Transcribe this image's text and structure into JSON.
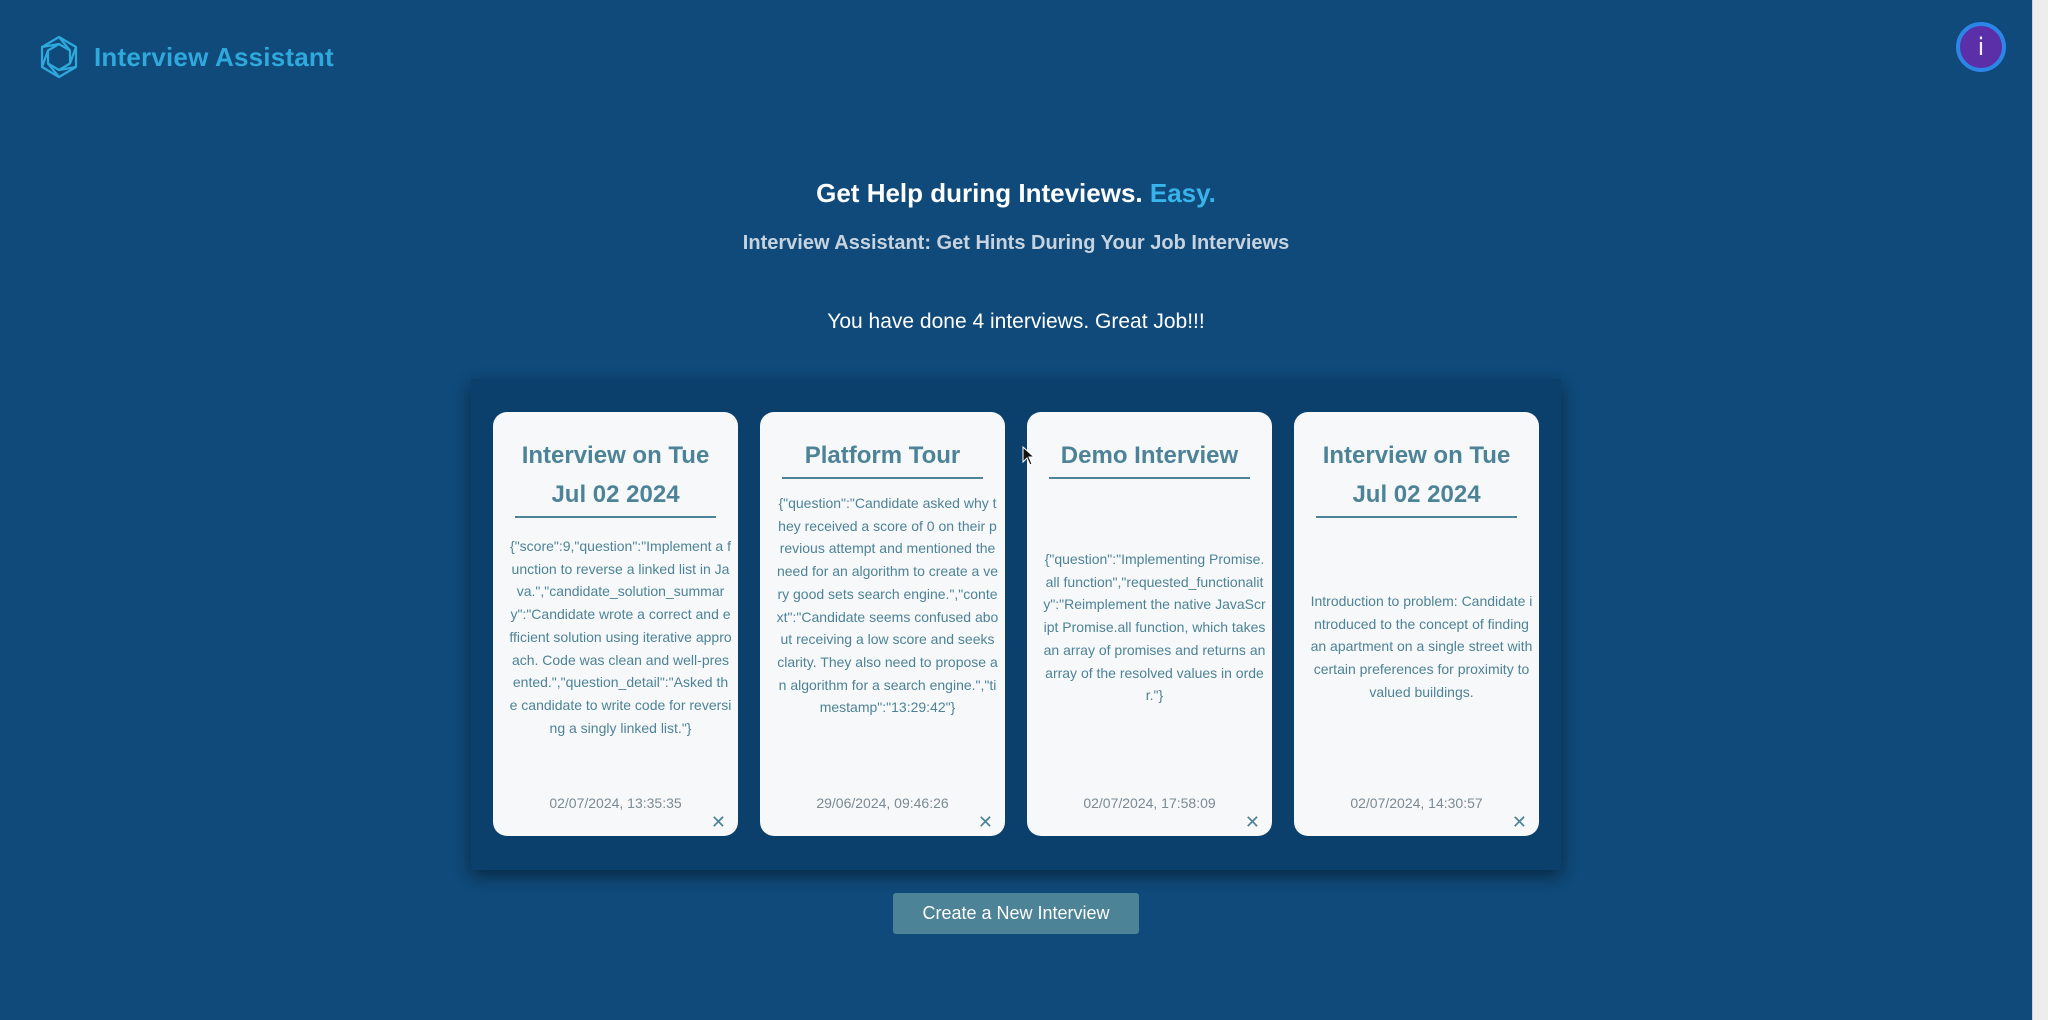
{
  "header": {
    "app_title": "Interview Assistant",
    "logo_icon": "hexagon-spiral-logo-icon",
    "avatar_letter": "i",
    "avatar_color": "#5a2fa8"
  },
  "hero": {
    "title_main": "Get Help during Inteviews. ",
    "title_accent": "Easy.",
    "subtitle": "Interview Assistant: Get Hints During Your Job Interviews",
    "count_text": "You have done 4 interviews. Great Job!!!"
  },
  "cards": [
    {
      "title": "Interview on Tue Jul 02 2024",
      "body": "{\"score\":9,\"question\":\"Implement a function to reverse a linked list in Java.\",\"candidate_solution_summary\":\"Candidate wrote a correct and efficient solution using iterative approach. Code was clean and well-presented.\",\"question_detail\":\"Asked the candidate to write code for reversing a singly linked list.\"}",
      "timestamp": "02/07/2024, 13:35:35"
    },
    {
      "title": "Platform Tour",
      "body": "{\"question\":\"Candidate asked why they received a score of 0 on their previous attempt and mentioned the need for an algorithm to create a very good sets search engine.\",\"context\":\"Candidate seems confused about receiving a low score and seeks clarity. They also need to propose an algorithm for a search engine.\",\"timestamp\":\"13:29:42\"}",
      "timestamp": "29/06/2024, 09:46:26"
    },
    {
      "title": "Demo Interview",
      "body": "{\"question\":\"Implementing Promise.all function\",\"requested_functionality\":\"Reimplement the native JavaScript Promise.all function, which takes an array of promises and returns an array of the resolved values in order.\"}",
      "timestamp": "02/07/2024, 17:58:09"
    },
    {
      "title": "Interview on Tue Jul 02 2024",
      "body": "Introduction to problem: Candidate introduced to the concept of finding an apartment on a single street with certain preferences for proximity to valued buildings.",
      "timestamp": "02/07/2024, 14:30:57"
    }
  ],
  "close_glyph": "✕",
  "cta": {
    "label": "Create a New Interview"
  },
  "colors": {
    "background": "#0f4a7a",
    "accent": "#39b4ea",
    "card_text": "#4d8396",
    "button": "#4d8396"
  }
}
